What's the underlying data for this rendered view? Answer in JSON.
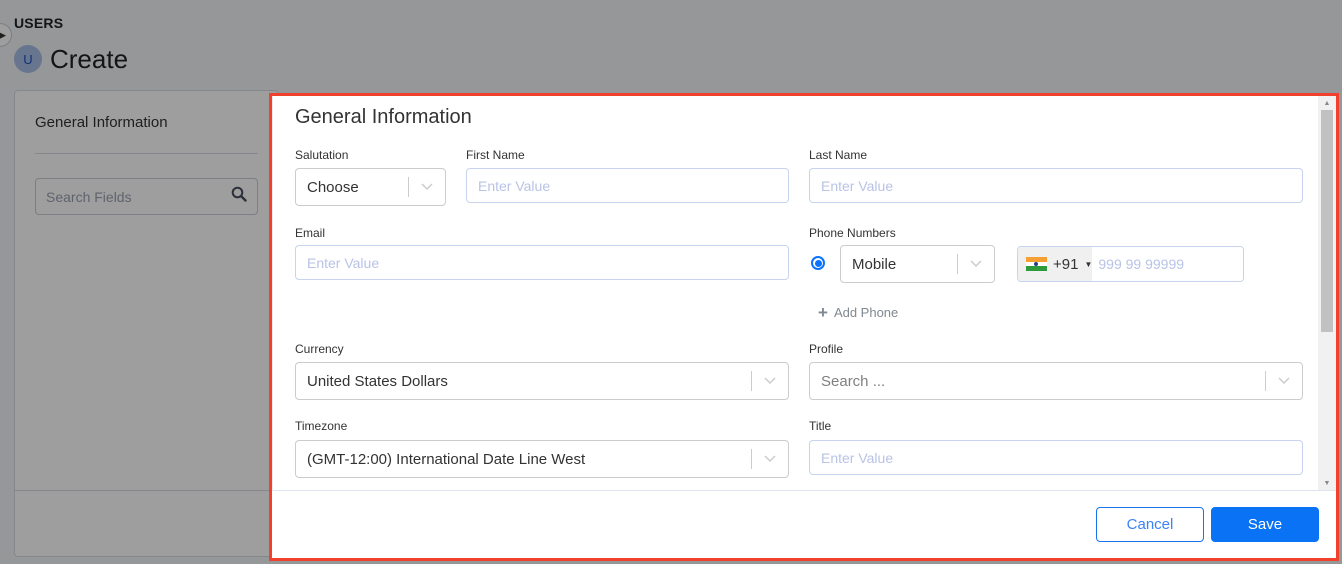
{
  "page": {
    "module": "USERS",
    "avatar_letter": "U",
    "title": "Create"
  },
  "sidebar": {
    "section_title": "General Information",
    "search_placeholder": "Search Fields"
  },
  "modal": {
    "section_title": "General Information",
    "fields": {
      "salutation": {
        "label": "Salutation",
        "value": "Choose"
      },
      "first_name": {
        "label": "First Name",
        "placeholder": "Enter Value",
        "value": ""
      },
      "last_name": {
        "label": "Last Name",
        "placeholder": "Enter Value",
        "value": ""
      },
      "email": {
        "label": "Email",
        "placeholder": "Enter Value",
        "value": ""
      },
      "phone_numbers": {
        "label": "Phone Numbers",
        "primary_selected": true,
        "type": "Mobile",
        "country_code": "+91",
        "country_flag": "india-flag-icon",
        "placeholder": "999 99 99999",
        "value": "",
        "add_label": "Add Phone"
      },
      "currency": {
        "label": "Currency",
        "value": "United States Dollars"
      },
      "profile": {
        "label": "Profile",
        "placeholder": "Search ..."
      },
      "timezone": {
        "label": "Timezone",
        "value": "(GMT-12:00) International Date Line West"
      },
      "title": {
        "label": "Title",
        "placeholder": "Enter Value",
        "value": ""
      }
    },
    "footer": {
      "cancel_label": "Cancel",
      "save_label": "Save"
    }
  },
  "colors": {
    "primary": "#0a73f5",
    "highlight_border": "#f0412d"
  }
}
